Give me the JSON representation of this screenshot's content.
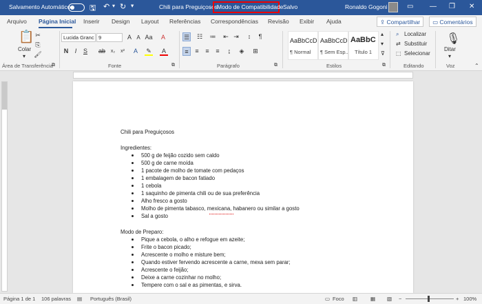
{
  "titlebar": {
    "autosave_label": "Salvamento Automático",
    "doc_name": "Chili para Preguiçosos",
    "sep": "-",
    "compat_mode": "Modo de Compatibilidade",
    "saved": "Salvo",
    "user": "Ronaldo Gogoni",
    "minimize": "—",
    "restore": "❐",
    "close": "✕"
  },
  "menu": {
    "tabs": [
      "Arquivo",
      "Página Inicial",
      "Inserir",
      "Design",
      "Layout",
      "Referências",
      "Correspondências",
      "Revisão",
      "Exibir",
      "Ajuda"
    ],
    "share": "Compartilhar",
    "comments": "Comentários"
  },
  "ribbon": {
    "clipboard": {
      "paste": "Colar",
      "label": "Área de Transferência"
    },
    "font": {
      "name": "Lucida Granc",
      "size": "9",
      "label": "Fonte"
    },
    "paragraph": {
      "label": "Parágrafo"
    },
    "styles": {
      "label": "Estilos",
      "items": [
        {
          "preview": "AaBbCcD",
          "name": "¶ Normal"
        },
        {
          "preview": "AaBbCcD",
          "name": "¶ Sem Esp..."
        },
        {
          "preview": "AaBbC",
          "name": "Título 1"
        }
      ]
    },
    "editing": {
      "label": "Editando",
      "find": "Localizar",
      "replace": "Substituir",
      "select": "Selecionar"
    },
    "voice": {
      "label": "Voz",
      "dictate": "Ditar"
    }
  },
  "document": {
    "title": "Chili para Preguiçosos",
    "ingredients_heading": "Ingredientes:",
    "ingredients": [
      "500 g de feijão cozido sem caldo",
      "500 g de carne moída",
      "1 pacote de molho de tomate com pedaços",
      "1 embalagem de bacon fatiado",
      "1 cebola",
      "1 saquinho de pimenta chili ou de sua preferência",
      "Alho fresco a gosto",
      "Molho de pimenta tabasco, mexicana, habanero ou similar a gosto",
      "Sal a gosto"
    ],
    "prep_heading": "Modo de Preparo:",
    "steps": [
      "Pique a cebola, o alho e refogue em azeite;",
      "Frite o bacon picado;",
      "Acrescente o molho e misture bem;",
      "Quando estiver fervendo acrescente a carne, mexa sem parar;",
      "Acrescente o feijão;",
      "Deixe a carne cozinhar no molho;",
      "Tempere com o sal e as pimentas, e sirva."
    ]
  },
  "status": {
    "page": "Página 1 de 1",
    "words": "106 palavras",
    "language": "Português (Brasil)",
    "focus": "Foco",
    "zoom": "100%"
  },
  "colors": {
    "accent": "#2b579a",
    "highlight": "#e00000"
  }
}
